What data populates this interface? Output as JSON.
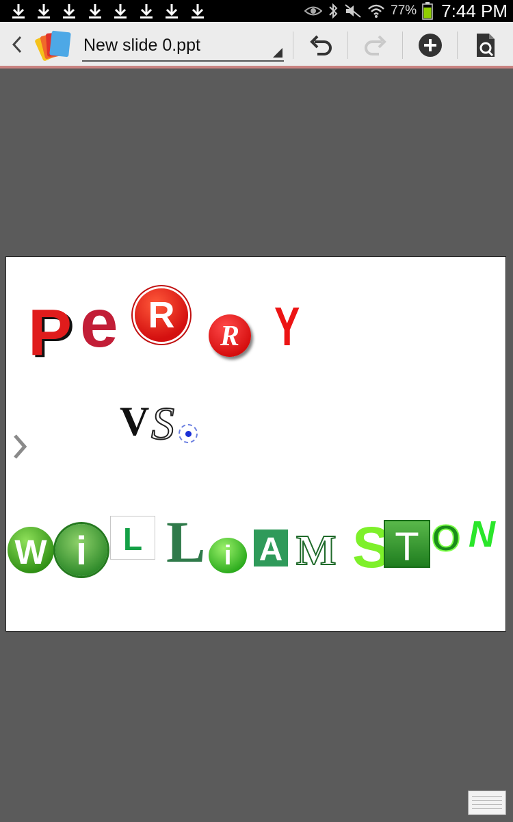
{
  "status": {
    "battery_percent": "77%",
    "time": "7:44 PM"
  },
  "toolbar": {
    "file_name": "New slide 0.ppt"
  },
  "slide": {
    "line1": [
      "P",
      "e",
      "R",
      "R",
      "Y"
    ],
    "line2": [
      "V",
      "S"
    ],
    "line3": [
      "W",
      "i",
      "L",
      "L",
      "i",
      "A",
      "M",
      "S",
      "T",
      "O",
      "N"
    ]
  },
  "colors": {
    "toolbar_bg": "#ececec",
    "accent_line": "#c98381",
    "workspace_bg": "#5b5b5b",
    "red": "#e01c1c",
    "green": "#2eaa2e"
  }
}
